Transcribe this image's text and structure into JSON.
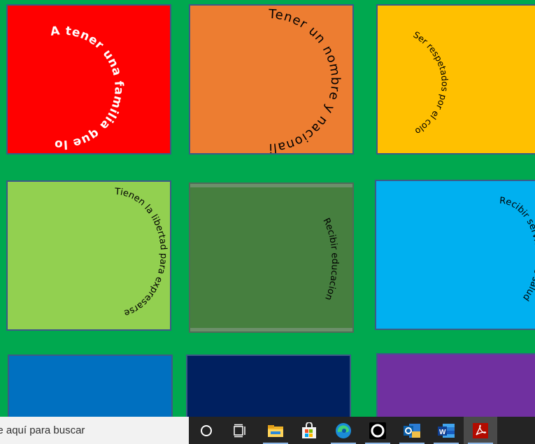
{
  "cards": [
    {
      "id": "c1",
      "text": "A tener una familia que los cuide y te proteja",
      "bg": "#ff0000",
      "fg": "#ffffff"
    },
    {
      "id": "c2",
      "text": "Tener un nombre y nacionalidad",
      "bg": "#ed7d31",
      "fg": "#000000"
    },
    {
      "id": "c3",
      "text": "Ser respetados por el color del piel, por gustos, creencias y apariencia",
      "bg": "#ffc000",
      "fg": "#000000"
    },
    {
      "id": "c4",
      "text": "Tienen la libertad para expresarse",
      "bg": "#92d050",
      "fg": "#000000"
    },
    {
      "id": "c5",
      "text": "Recibir educacion",
      "bg": "#467f3f",
      "fg": "#000000"
    },
    {
      "id": "c6",
      "text": "Recibir servicios de salud",
      "bg": "#00b0f0",
      "fg": "#000000"
    },
    {
      "id": "c7",
      "text": "",
      "bg": "#0070c0",
      "fg": "#000000"
    },
    {
      "id": "c8",
      "text": "",
      "bg": "#002060",
      "fg": "#000000"
    },
    {
      "id": "c9",
      "text": "",
      "bg": "#7030a0",
      "fg": "#000000"
    }
  ],
  "taskbar": {
    "search_placeholder": "Escribe aquí para buscar",
    "search_visible_text": "pe aquí para buscar",
    "apps": [
      "cortana-icon",
      "task-view-icon",
      "file-explorer-icon",
      "microsoft-store-icon",
      "edge-icon",
      "obs-icon",
      "outlook-icon",
      "word-icon",
      "acrobat-icon"
    ],
    "active_app": "acrobat-icon"
  }
}
